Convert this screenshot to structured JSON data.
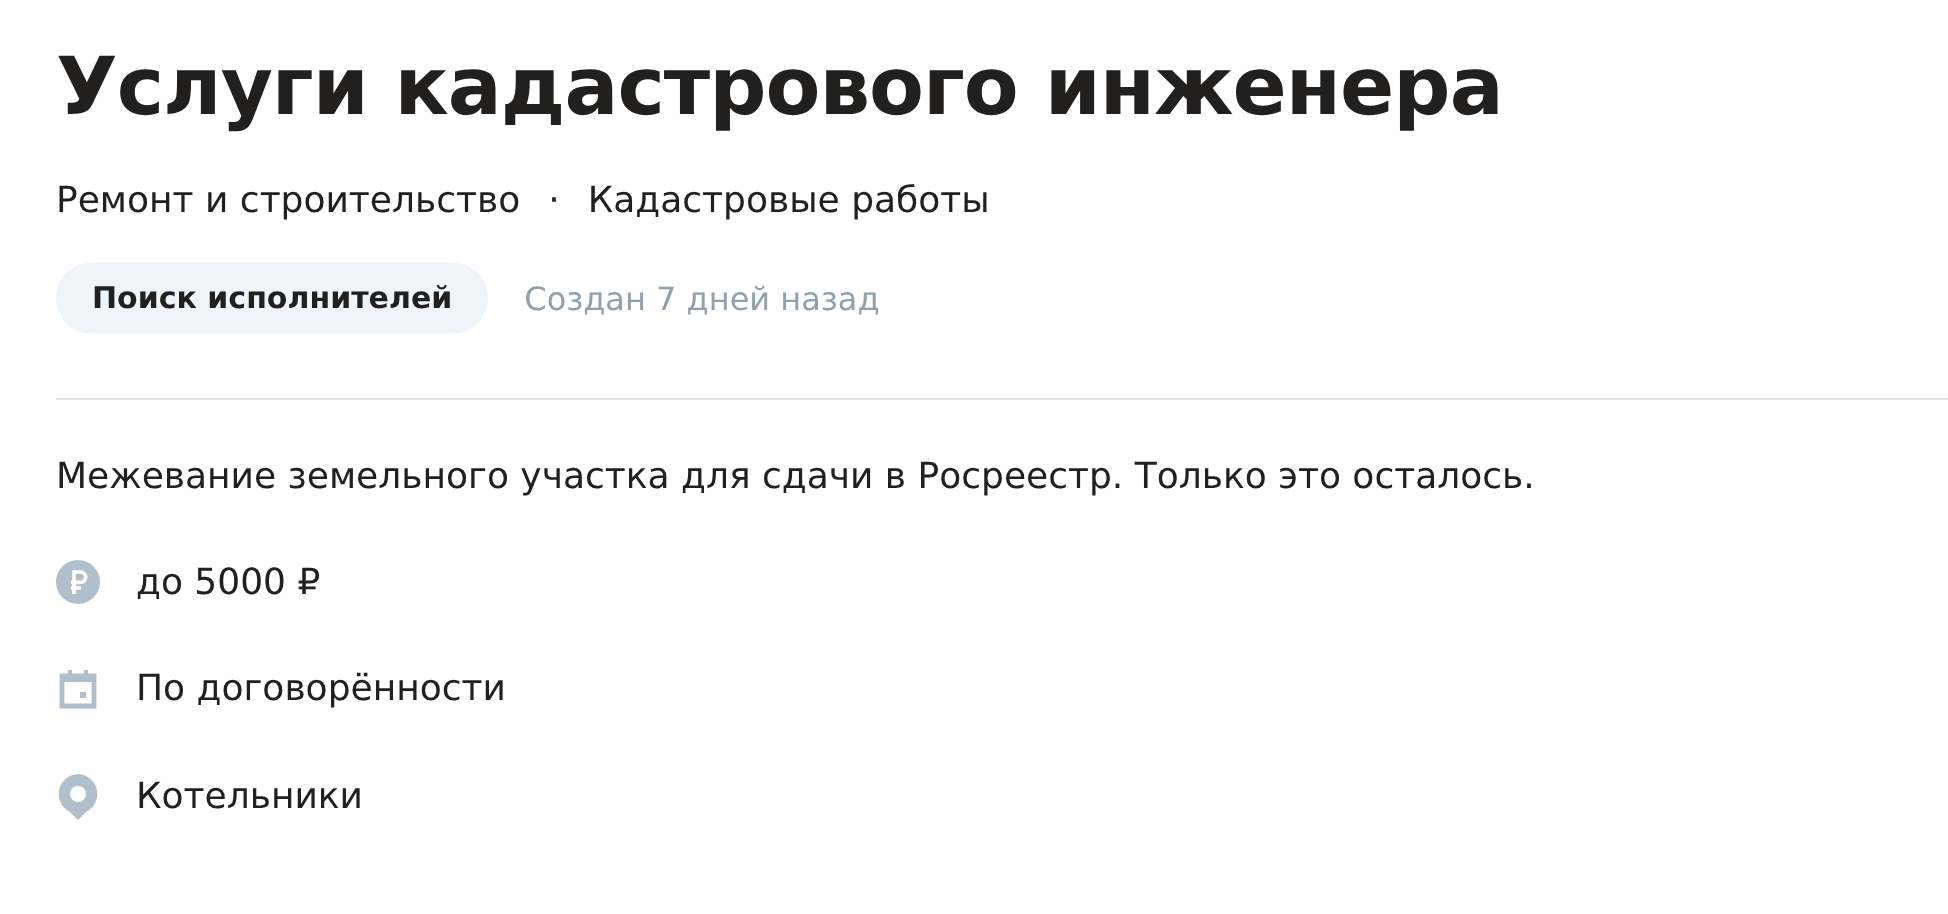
{
  "title": "Услуги кадастрового инженера",
  "categories": [
    "Ремонт и строительство",
    "Кадастровые работы"
  ],
  "separator": "·",
  "status": {
    "label": "Поиск исполнителей",
    "created": "Создан 7 дней назад"
  },
  "description": "Межевание земельного участка для сдачи в Росреестр. Только это осталось.",
  "details": [
    {
      "kind": "price",
      "text": "до 5000 ₽"
    },
    {
      "kind": "date",
      "text": "По договорённости"
    },
    {
      "kind": "location",
      "text": "Котельники"
    }
  ]
}
